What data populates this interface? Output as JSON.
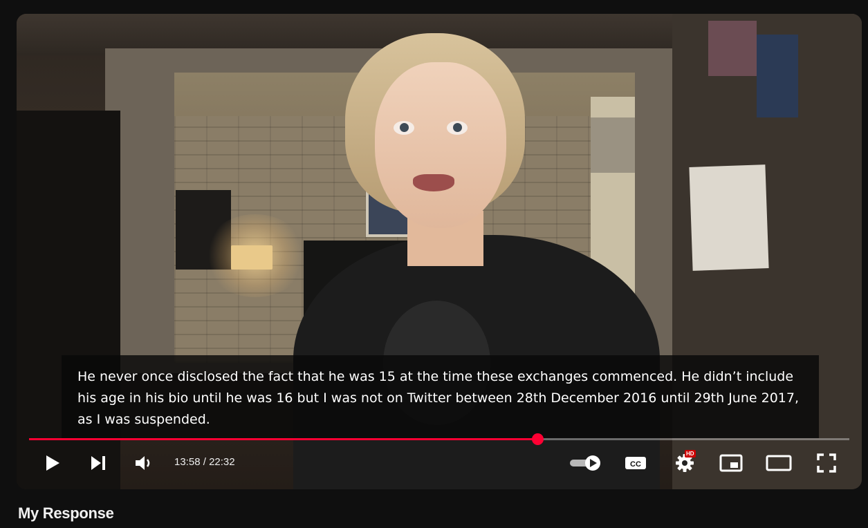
{
  "player": {
    "caption": "He never once disclosed the fact that he was 15 at the time these exchanges commenced. He didn’t include his age in his bio until he was 16 but I was not on Twitter between 28th December 2016 until 29th June 2017, as I was suspended.",
    "time_current": "13:58",
    "time_total": "22:32",
    "time_separator": " / ",
    "progress": 0.62,
    "accent_color": "#ff0033",
    "quality_badge": "HD",
    "controls": [
      "play-icon",
      "next-icon",
      "volume-icon",
      "autoplay-toggle",
      "subtitles-icon",
      "settings-icon",
      "miniplayer-icon",
      "theater-icon",
      "fullscreen-icon"
    ],
    "captions_label": "CC"
  },
  "video": {
    "title": "My Response"
  }
}
